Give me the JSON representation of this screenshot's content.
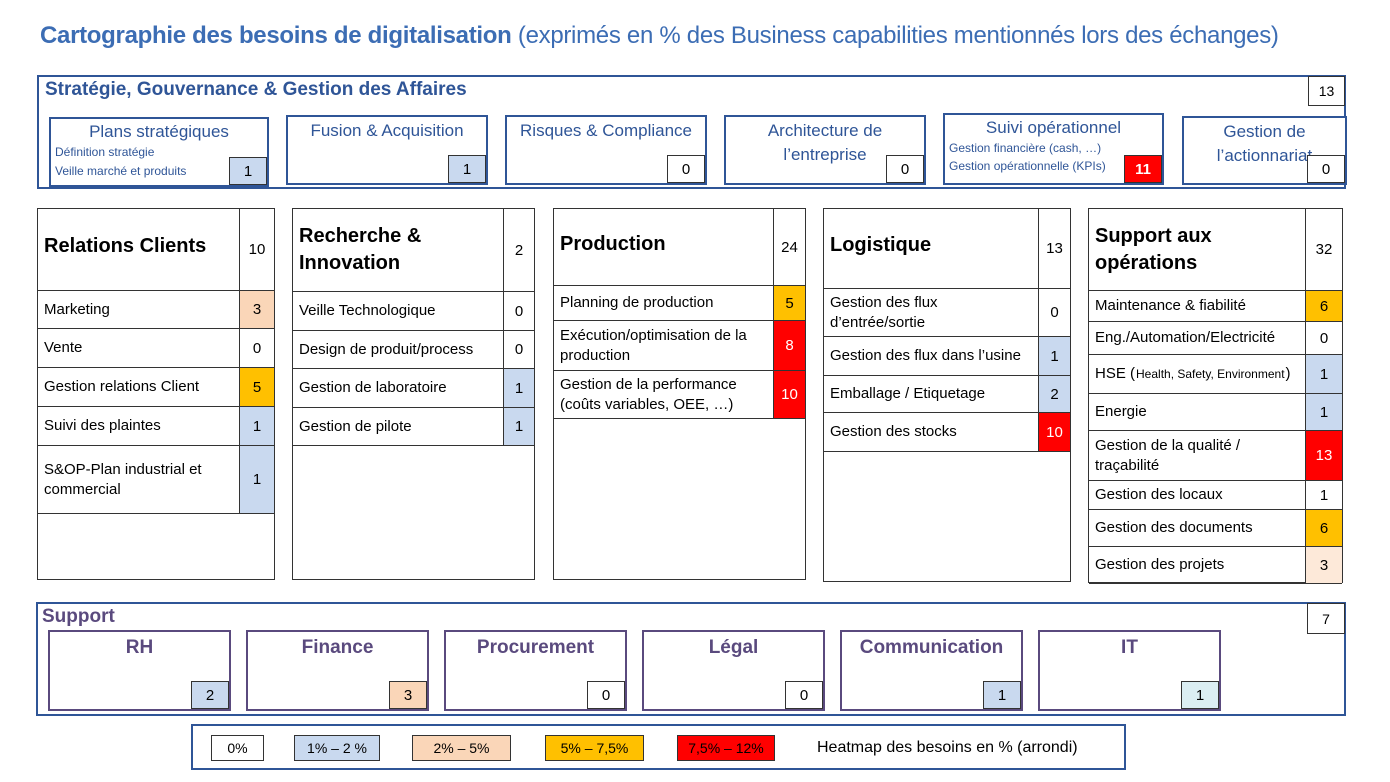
{
  "title": {
    "bold": "Cartographie des besoins de digitalisation",
    "rest": "(exprimés en % des Business capabilities mentionnés lors des échanges)"
  },
  "strategy": {
    "title": "Stratégie, Gouvernance & Gestion des Affaires",
    "total": "13",
    "items": [
      {
        "name": "Plans stratégiques",
        "details": [
          "Définition stratégie",
          "Veille marché et produits"
        ],
        "value": "1",
        "level": "blue"
      },
      {
        "name": "Fusion & Acquisition",
        "details": [],
        "value": "1",
        "level": "blue"
      },
      {
        "name": "Risques & Compliance",
        "details": [],
        "value": "0",
        "level": "white"
      },
      {
        "name": "Architecture de l’entreprise",
        "details": [],
        "value": "0",
        "level": "white"
      },
      {
        "name": "Suivi opérationnel",
        "details": [
          "Gestion financière (cash, …)",
          "Gestion opérationnelle (KPIs)"
        ],
        "value": "11",
        "level": "red"
      },
      {
        "name": "Gestion de l’actionnariat",
        "details": [],
        "value": "0",
        "level": "white"
      }
    ]
  },
  "columns": [
    {
      "title": "Relations Clients",
      "total": "10",
      "rows": [
        {
          "label": "Marketing",
          "value": "3",
          "level": "peach"
        },
        {
          "label": "Vente",
          "value": "0",
          "level": "white"
        },
        {
          "label": "Gestion relations Client",
          "value": "5",
          "level": "orange"
        },
        {
          "label": "Suivi des plaintes",
          "value": "1",
          "level": "blue"
        },
        {
          "label": "S&OP-Plan industrial et commercial",
          "value": "1",
          "level": "blue"
        }
      ]
    },
    {
      "title": "Recherche & Innovation",
      "total": "2",
      "rows": [
        {
          "label": "Veille Technologique",
          "value": "0",
          "level": "white"
        },
        {
          "label": "Design de produit/process",
          "value": "0",
          "level": "white"
        },
        {
          "label": "Gestion de laboratoire",
          "value": "1",
          "level": "blue"
        },
        {
          "label": "Gestion de pilote",
          "value": "1",
          "level": "blue"
        }
      ]
    },
    {
      "title": "Production",
      "total": "24",
      "rows": [
        {
          "label": "Planning de production",
          "value": "5",
          "level": "orange"
        },
        {
          "label": "Exécution/optimisation de la production",
          "value": "8",
          "level": "red"
        },
        {
          "label": "Gestion de la performance (coûts variables, OEE, …)",
          "value": "10",
          "level": "red"
        }
      ]
    },
    {
      "title": "Logistique",
      "total": "13",
      "rows": [
        {
          "label": "Gestion des flux d’entrée/sortie",
          "value": "0",
          "level": "white"
        },
        {
          "label": "Gestion des flux dans l’usine",
          "value": "1",
          "level": "blue"
        },
        {
          "label": "Emballage / Etiquetage",
          "value": "2",
          "level": "blue"
        },
        {
          "label": "Gestion des stocks",
          "value": "10",
          "level": "red"
        }
      ]
    },
    {
      "title": "Support aux opérations",
      "total": "32",
      "rows": [
        {
          "label": "Maintenance & fiabilité",
          "value": "6",
          "level": "orange"
        },
        {
          "label": "Eng./Automation/Electricité",
          "value": "0",
          "level": "white"
        },
        {
          "label": "HSE (",
          "small": "Health, Safety, Environment",
          "label_end": ")",
          "value": "1",
          "level": "blue"
        },
        {
          "label": "Energie",
          "value": "1",
          "level": "blue"
        },
        {
          "label": "Gestion de la qualité / traçabilité",
          "value": "13",
          "level": "red"
        },
        {
          "label": "Gestion des locaux",
          "value": "1",
          "level": "white"
        },
        {
          "label": "Gestion des documents",
          "value": "6",
          "level": "orange"
        },
        {
          "label": "Gestion des projets",
          "value": "3",
          "level": "lightpeach"
        }
      ]
    }
  ],
  "support": {
    "title": "Support",
    "total": "7",
    "items": [
      {
        "name": "RH",
        "value": "2",
        "level": "blue"
      },
      {
        "name": "Finance",
        "value": "3",
        "level": "peach"
      },
      {
        "name": "Procurement",
        "value": "0",
        "level": "white"
      },
      {
        "name": "Légal",
        "value": "0",
        "level": "white"
      },
      {
        "name": "Communication",
        "value": "1",
        "level": "blue"
      },
      {
        "name": "IT",
        "value": "1",
        "level": "lightblue"
      }
    ]
  },
  "legend": {
    "items": [
      {
        "label": "0%",
        "level": "white"
      },
      {
        "label": "1% – 2 %",
        "level": "blue"
      },
      {
        "label": "2% – 5%",
        "level": "peach"
      },
      {
        "label": "5% – 7,5%",
        "level": "orange"
      },
      {
        "label": "7,5% – 12%",
        "level": "red"
      }
    ],
    "text": "Heatmap des besoins en % (arrondi)"
  },
  "colors": {
    "white": "#ffffff",
    "blue": "#c9d9ef",
    "peach": "#fad6b8",
    "lightpeach": "#fde9d9",
    "orange": "#ffc000",
    "red": "#ff0000",
    "lightblue": "#dbeef3",
    "strategy_border": "#2f5597",
    "support_purple": "#5a4a7e",
    "title_blue": "#3c6db4"
  }
}
